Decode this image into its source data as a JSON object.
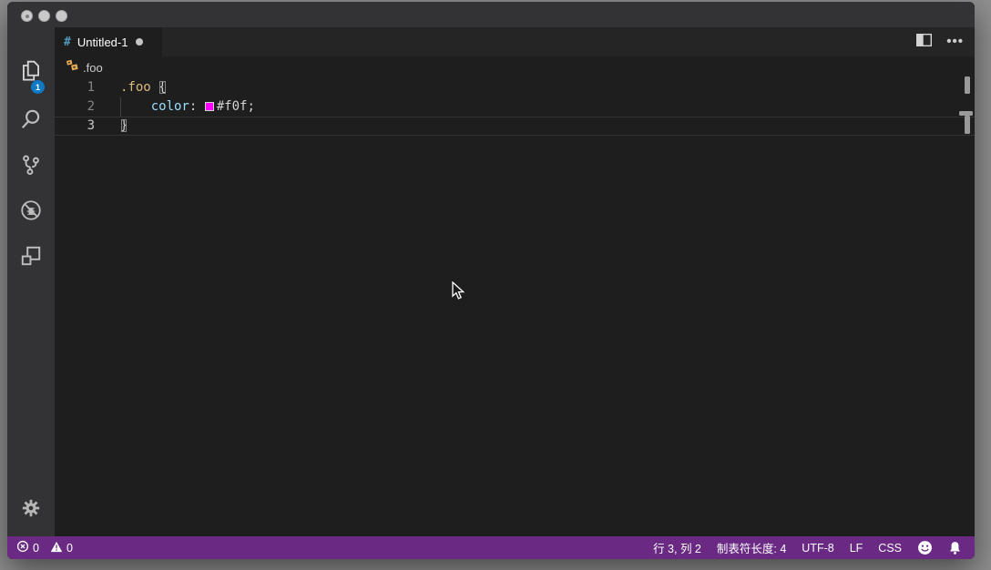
{
  "window": {
    "traffic_lights": [
      "close",
      "minimize",
      "zoom"
    ]
  },
  "activity_bar": {
    "items": [
      {
        "name": "explorer",
        "badge": "1"
      },
      {
        "name": "search"
      },
      {
        "name": "source-control"
      },
      {
        "name": "debug"
      },
      {
        "name": "extensions"
      }
    ],
    "settings": {
      "name": "settings-gear"
    }
  },
  "tab_bar": {
    "tabs": [
      {
        "label": "Untitled-1",
        "language": "css",
        "lang_glyph": "#",
        "modified": true
      }
    ],
    "more_label": "•••"
  },
  "breadcrumb": {
    "symbol": ".foo",
    "symbol_icon": "symbol-class"
  },
  "editor": {
    "language": "css",
    "active_line": 3,
    "lines": [
      {
        "num": "1",
        "tokens": {
          "selector": ".foo ",
          "brace": "{"
        }
      },
      {
        "num": "2",
        "tokens": {
          "indent": "    ",
          "prop": "color",
          "colon": ": ",
          "value": "#f0f;"
        }
      },
      {
        "num": "3",
        "tokens": {
          "brace": "}"
        }
      }
    ],
    "swatch_color": "#ff00ff"
  },
  "status_bar": {
    "errors": "0",
    "warnings": "0",
    "right_items": [
      {
        "name": "cursor-position",
        "label": "行 3, 列 2"
      },
      {
        "name": "tab-size",
        "label": "制表符长度: 4"
      },
      {
        "name": "encoding",
        "label": "UTF-8"
      },
      {
        "name": "eol",
        "label": "LF"
      },
      {
        "name": "language-mode",
        "label": "CSS"
      }
    ]
  },
  "colors": {
    "status_bar": "#6a2a84",
    "badge": "#1079c4",
    "selector": "#d7ba7d",
    "property": "#9cdcfe",
    "swatch": "#ff00ff",
    "editor_bg": "#1e1e1e",
    "chrome_bg": "#333336",
    "tabstrip_bg": "#252526"
  }
}
